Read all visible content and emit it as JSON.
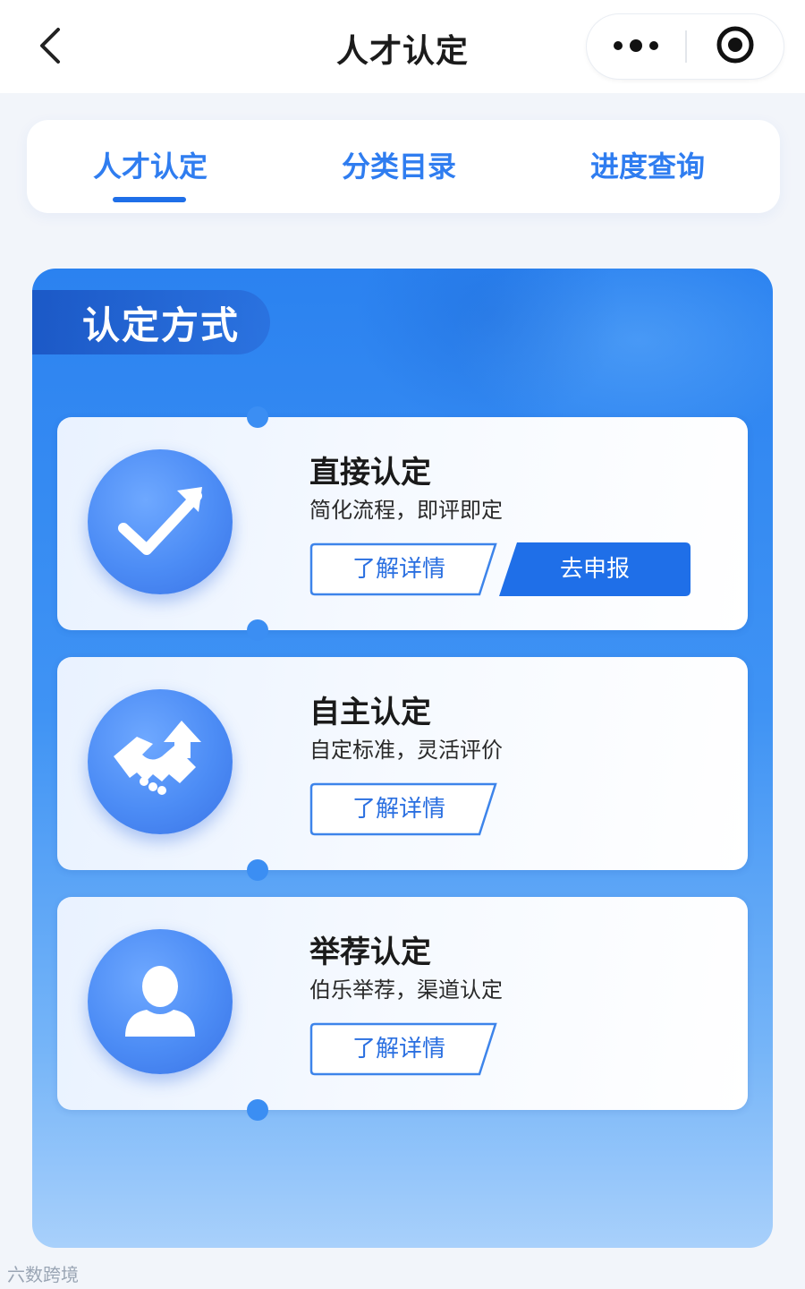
{
  "header": {
    "title": "人才认定"
  },
  "tabs": [
    {
      "label": "人才认定",
      "active": true
    },
    {
      "label": "分类目录",
      "active": false
    },
    {
      "label": "进度查询",
      "active": false
    }
  ],
  "section": {
    "label": "认定方式",
    "cards": [
      {
        "title": "直接认定",
        "subtitle": "简化流程，即评即定",
        "icon": "check-arrow-icon",
        "detail_label": "了解详情",
        "apply_label": "去申报"
      },
      {
        "title": "自主认定",
        "subtitle": "自定标准，灵活评价",
        "icon": "handshake-icon",
        "detail_label": "了解详情"
      },
      {
        "title": "举荐认定",
        "subtitle": "伯乐举荐，渠道认定",
        "icon": "person-icon",
        "detail_label": "了解详情"
      }
    ]
  },
  "watermark": "六数跨境",
  "colors": {
    "accent": "#2f7df0",
    "primary_button": "#1f6fe8",
    "panel_top": "#2b82f0",
    "panel_bottom": "#a8d0fb"
  }
}
